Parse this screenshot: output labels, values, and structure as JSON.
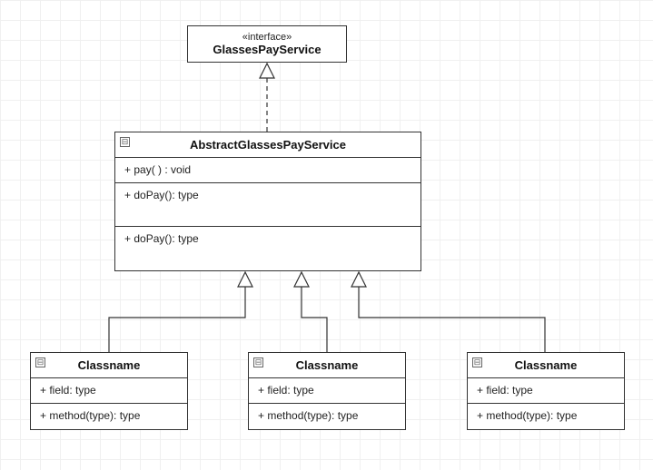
{
  "interface": {
    "stereotype": "«interface»",
    "name": "GlassesPayService"
  },
  "abstractClass": {
    "name": "AbstractGlassesPayService",
    "methods": [
      "+ pay( ) :   void",
      "+ doPay(): type",
      "+ doPay(): type"
    ]
  },
  "subclasses": [
    {
      "name": "Classname",
      "field": "+ field: type",
      "method": "+ method(type): type"
    },
    {
      "name": "Classname",
      "field": "+ field: type",
      "method": "+ method(type): type"
    },
    {
      "name": "Classname",
      "field": "+ field: type",
      "method": "+ method(type): type"
    }
  ],
  "collapseGlyph": "▣"
}
